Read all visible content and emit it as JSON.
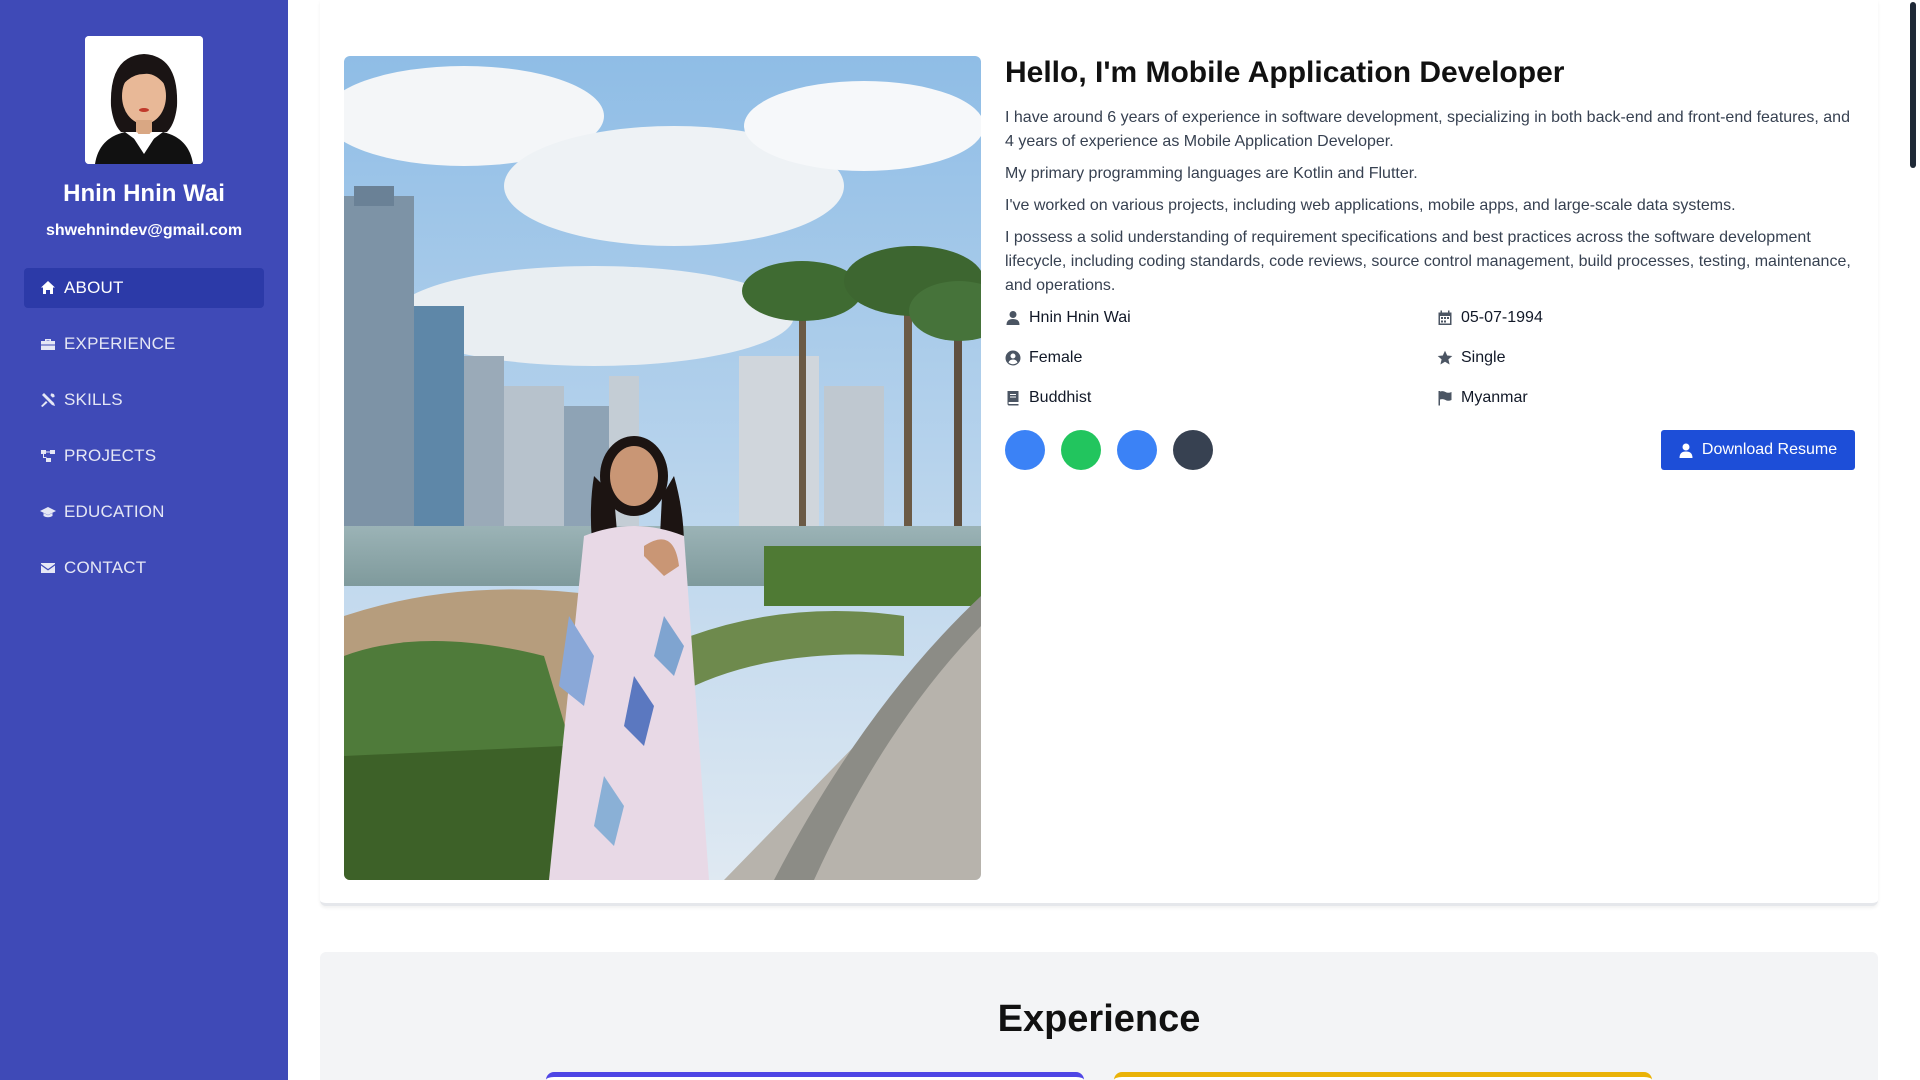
{
  "sidebar": {
    "name": "Hnin Hnin Wai",
    "email": "shwehnindev@gmail.com",
    "items": [
      {
        "label": "ABOUT",
        "icon": "home-icon"
      },
      {
        "label": "EXPERIENCE",
        "icon": "briefcase-icon"
      },
      {
        "label": "SKILLS",
        "icon": "tools-icon"
      },
      {
        "label": "PROJECTS",
        "icon": "diagram-icon"
      },
      {
        "label": "EDUCATION",
        "icon": "graduation-cap-icon"
      },
      {
        "label": "CONTACT",
        "icon": "envelope-icon"
      }
    ],
    "active": "ABOUT"
  },
  "about": {
    "title": "Hello, I'm Mobile Application Developer",
    "paragraphs": [
      "I have around 6 years of experience in software development, specializing in both back-end and front-end features, and 4 years of experience as Mobile Application Developer.",
      "My primary programming languages are Kotlin and Flutter.",
      "I've worked on various projects, including web applications, mobile apps, and large-scale data systems.",
      "I possess a solid understanding of requirement specifications and best practices across the software development lifecycle, including coding standards, code reviews, source control management, build processes, testing, maintenance, and operations."
    ],
    "facts": {
      "name": "Hnin Hnin Wai",
      "dob": "05-07-1994",
      "gender": "Female",
      "marital": "Single",
      "religion": "Buddhist",
      "nationality": "Myanmar"
    },
    "download_label": "Download Resume"
  },
  "experience": {
    "title": "Experience"
  },
  "colors": {
    "sidebar_bg": "#3f4ab7",
    "sidebar_active": "#2c3aa8",
    "primary_button": "#1d4ed8",
    "social_facebook": "#3b82f6",
    "social_whatsapp": "#22c55e",
    "social_linkedin": "#3b82f6",
    "social_github": "#374151",
    "exp_card_1": "#4f46e5",
    "exp_card_2": "#eab308"
  }
}
